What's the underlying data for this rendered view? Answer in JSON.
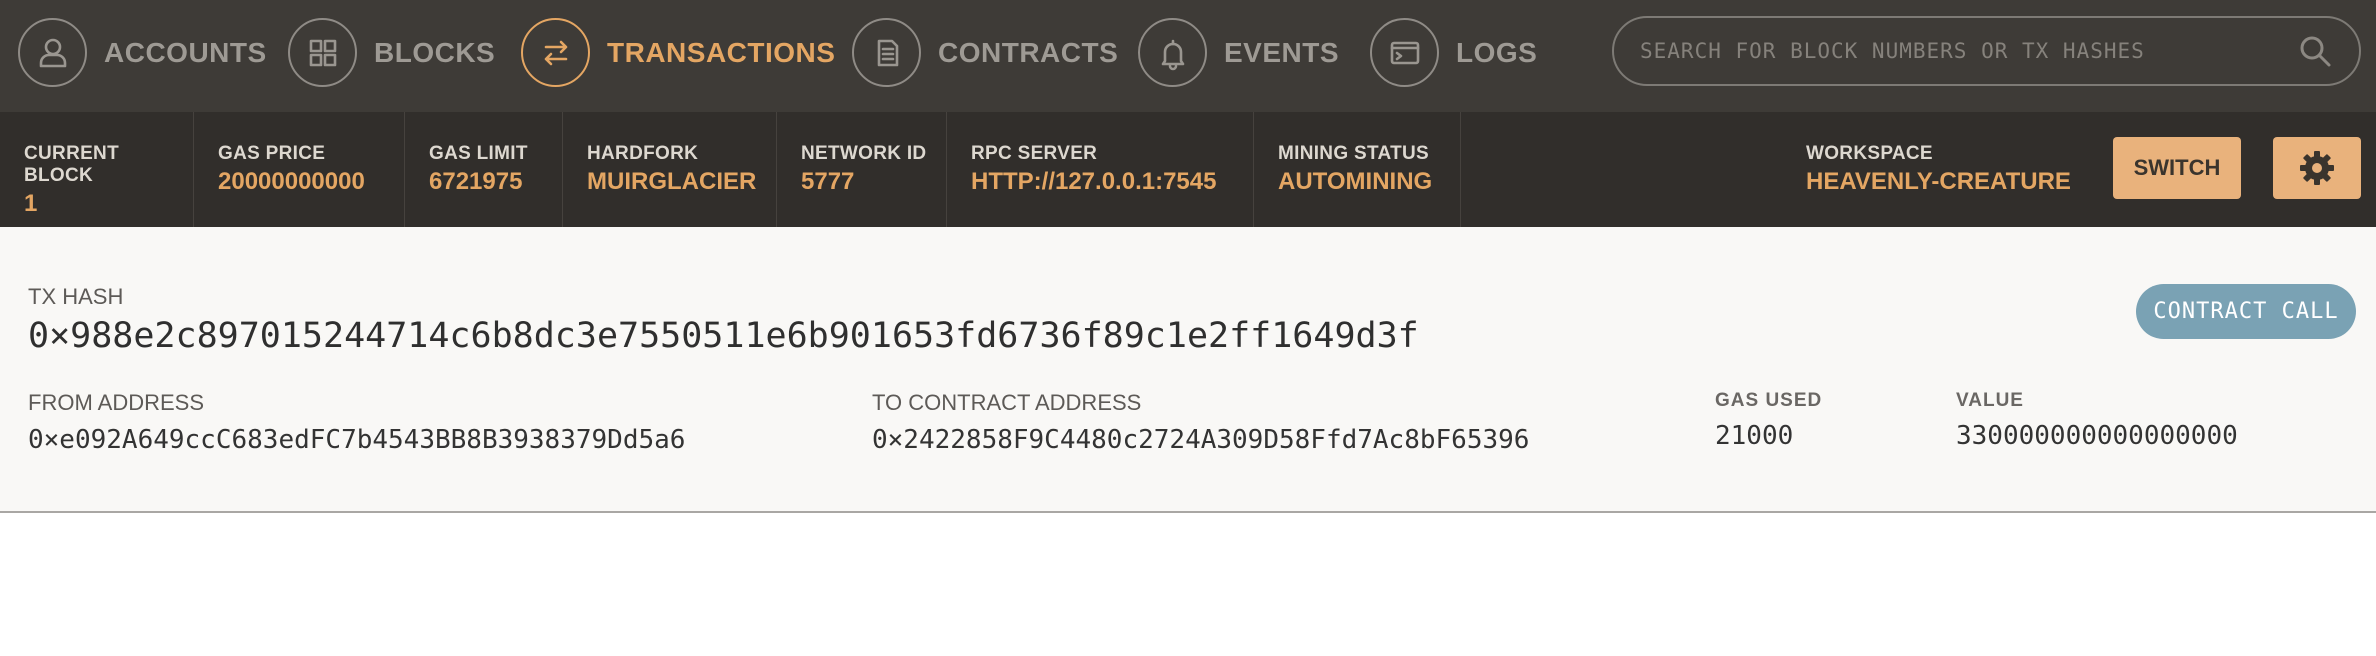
{
  "nav": {
    "items": [
      {
        "label": "ACCOUNTS",
        "icon": "account-icon"
      },
      {
        "label": "BLOCKS",
        "icon": "blocks-icon"
      },
      {
        "label": "TRANSACTIONS",
        "icon": "transactions-icon",
        "active": true
      },
      {
        "label": "CONTRACTS",
        "icon": "contracts-icon"
      },
      {
        "label": "EVENTS",
        "icon": "bell-icon"
      },
      {
        "label": "LOGS",
        "icon": "terminal-icon"
      }
    ],
    "search_placeholder": "SEARCH FOR BLOCK NUMBERS OR TX HASHES"
  },
  "status": {
    "current_block": {
      "label": "CURRENT BLOCK",
      "value": "1"
    },
    "gas_price": {
      "label": "GAS PRICE",
      "value": "20000000000"
    },
    "gas_limit": {
      "label": "GAS LIMIT",
      "value": "6721975"
    },
    "hardfork": {
      "label": "HARDFORK",
      "value": "MUIRGLACIER"
    },
    "network_id": {
      "label": "NETWORK ID",
      "value": "5777"
    },
    "rpc_server": {
      "label": "RPC SERVER",
      "value": "HTTP://127.0.0.1:7545"
    },
    "mining_status": {
      "label": "MINING STATUS",
      "value": "AUTOMINING"
    },
    "workspace": {
      "label": "WORKSPACE",
      "value": "HEAVENLY-CREATURE"
    },
    "switch_label": "SWITCH"
  },
  "tx": {
    "hash_label": "TX HASH",
    "hash": "0×988e2c897015244714c6b8dc3e7550511e6b901653fd6736f89c1e2ff1649d3f",
    "badge": "CONTRACT CALL",
    "from_label": "FROM ADDRESS",
    "from": "0×e092A649ccC683edFC7b4543BB8B3938379Dd5a6",
    "to_label": "TO CONTRACT ADDRESS",
    "to": "0×2422858F9C4480c2724A309D58Ffd7Ac8bF65396",
    "gas_used_label": "GAS USED",
    "gas_used": "21000",
    "value_label": "VALUE",
    "value": "330000000000000000"
  },
  "colors": {
    "accent": "#e4a663",
    "nav_bg": "#3e3b37",
    "status_bg": "#312e2b",
    "badge": "#7aa2b4"
  }
}
